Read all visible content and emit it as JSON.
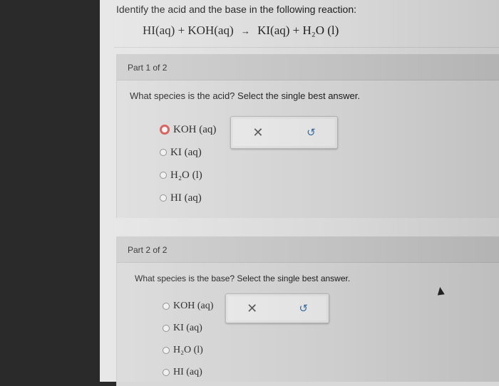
{
  "prompt": "Identify the acid and the base in the following reaction:",
  "equation": {
    "lhs1": "HI(aq)",
    "plus1": "+",
    "lhs2": "KOH(aq)",
    "rhs1": "KI(aq)",
    "plus2": "+",
    "rhs2": "H₂O (l)"
  },
  "part1": {
    "header": "Part 1 of 2",
    "question": "What species is the acid? Select the single best answer.",
    "options": [
      "KOH (aq)",
      "KI (aq)",
      "H₂O (l)",
      "HI (aq)"
    ],
    "selected_index": 0,
    "clear_glyph": "✕",
    "undo_glyph": "↺"
  },
  "part2": {
    "header": "Part 2 of 2",
    "question": "What species is the base? Select the single best answer.",
    "options": [
      "KOH (aq)",
      "KI (aq)",
      "H₂O (l)",
      "HI (aq)"
    ],
    "selected_index": null,
    "clear_glyph": "✕",
    "undo_glyph": "↺"
  },
  "colors": {
    "selected_radio": "#d9534f",
    "undo_icon": "#3a6ea5"
  },
  "icons": [
    "clear-icon",
    "undo-icon",
    "mouse-cursor-icon"
  ]
}
